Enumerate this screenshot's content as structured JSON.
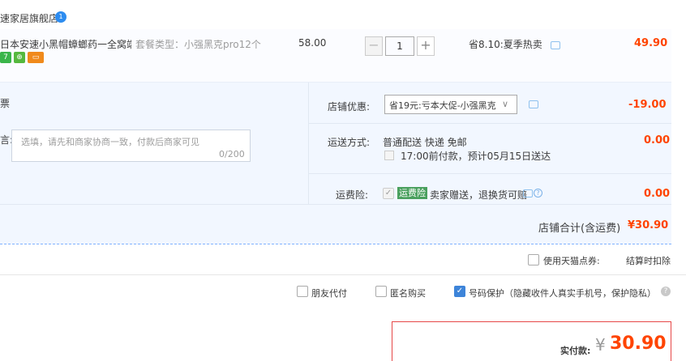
{
  "shop": {
    "name": "速家居旗舰店",
    "ww_badge": "1"
  },
  "item": {
    "title": "日本安速小黑帽蟑螂药一全窝端…",
    "sku": "套餐类型：小强黑克pro12个",
    "badges": [
      "7",
      "⊕",
      "▭"
    ],
    "badge_colors": [
      "#3ab54a",
      "#55b83e",
      "#f08a1c"
    ],
    "unit_price": "58.00",
    "quantity": "1",
    "minus": "−",
    "plus": "+",
    "discount": "省8.10:夏季热卖",
    "total": "49.90"
  },
  "invoice": {
    "label": "票"
  },
  "note": {
    "label": "言:",
    "placeholder": "选填，请先和商家协商一致，付款后商家可见",
    "count": "0/200"
  },
  "shop_promo": {
    "label": "店铺优惠:",
    "selected": "省19元:亏本大促-小强黑克",
    "amount": "-19.00"
  },
  "shipping": {
    "label": "运送方式:",
    "methods": "普通配送 快递 免邮",
    "eta": "17:00前付款，预计05月15日送达",
    "amount": "0.00"
  },
  "insurance": {
    "label": "运费险:",
    "tag": "运费险",
    "desc": "卖家赠送，退换货可赔",
    "amount": "0.00"
  },
  "shop_total": {
    "label": "店铺合计(含运费)",
    "amount": "¥30.90"
  },
  "points": {
    "label": "使用天猫点券:",
    "value": "结算时扣除"
  },
  "services": {
    "friend_pay": "朋友代付",
    "anonymous": "匿名购买",
    "privacy": "号码保护（隐藏收件人真实手机号，保护隐私）",
    "help": "?"
  },
  "payment": {
    "label": "实付款:",
    "currency": "¥",
    "amount": "30.90"
  },
  "icons": {
    "checkmark": "✓",
    "chevron": "∨",
    "question": "?"
  }
}
